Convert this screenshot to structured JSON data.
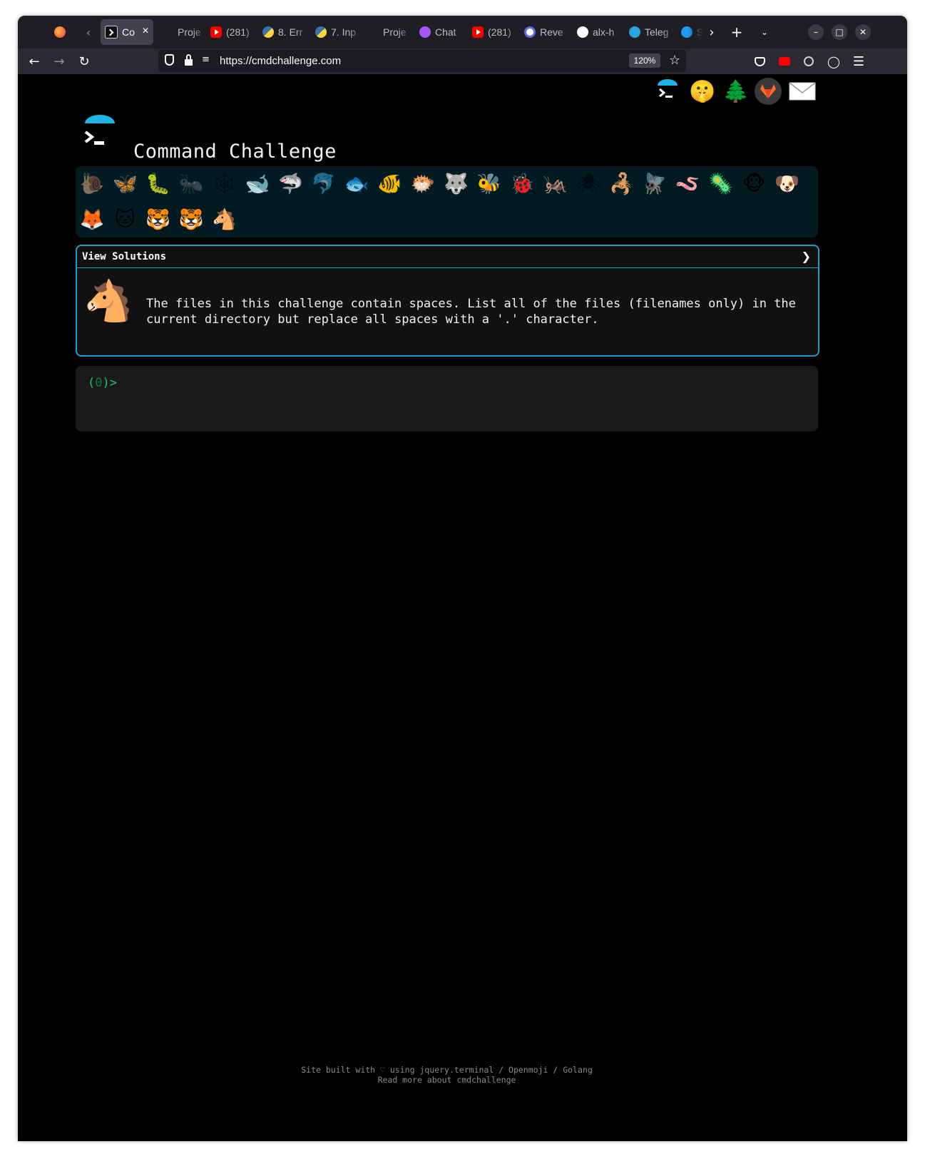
{
  "browser": {
    "tabs": [
      {
        "label": "Co",
        "icon": "terminal-icon",
        "active": true
      },
      {
        "label": "Proje",
        "icon": "blank-icon"
      },
      {
        "label": "(281)",
        "icon": "youtube-icon"
      },
      {
        "label": "8. Err",
        "icon": "python-icon"
      },
      {
        "label": "7. Inp",
        "icon": "python-icon"
      },
      {
        "label": "Proje",
        "icon": "blank-icon"
      },
      {
        "label": "Chat",
        "icon": "chat-icon"
      },
      {
        "label": "(281)",
        "icon": "youtube-icon"
      },
      {
        "label": "Reve",
        "icon": "reverso-icon"
      },
      {
        "label": "alx-h",
        "icon": "github-icon"
      },
      {
        "label": "Teleg",
        "icon": "telegram-icon"
      },
      {
        "label": "S",
        "icon": "twitter-icon"
      }
    ],
    "url": "https://cmdchallenge.com",
    "zoom": "120%"
  },
  "site": {
    "title": "Command Challenge",
    "header_icons": [
      "cmd-logo-icon",
      "shushing-face-icon",
      "tree-icon",
      "gitlab-icon",
      "envelope-icon"
    ]
  },
  "badges": [
    {
      "name": "snail-badge-icon",
      "glyph": "🐌",
      "dim": true
    },
    {
      "name": "butterfly-badge-icon",
      "glyph": "🦋"
    },
    {
      "name": "caterpillar-badge-icon",
      "glyph": "🐛"
    },
    {
      "name": "ant-badge-icon",
      "glyph": "🐜",
      "dim": true
    },
    {
      "name": "spider-web-badge-icon",
      "glyph": "🕸",
      "dim": true
    },
    {
      "name": "whale-badge-icon",
      "glyph": "🐋"
    },
    {
      "name": "shark-badge-icon",
      "glyph": "🦈"
    },
    {
      "name": "dolphin-badge-icon",
      "glyph": "🐬",
      "dim": true
    },
    {
      "name": "fish-badge-icon",
      "glyph": "🐟"
    },
    {
      "name": "tropical-fish-badge-icon",
      "glyph": "🐠"
    },
    {
      "name": "blowfish-badge-icon",
      "glyph": "🐡"
    },
    {
      "name": "wolf-badge-icon",
      "glyph": "🐺"
    },
    {
      "name": "bee-badge-icon",
      "glyph": "🐝"
    },
    {
      "name": "ladybug-badge-icon",
      "glyph": "🐞"
    },
    {
      "name": "cricket-badge-icon",
      "glyph": "🦗"
    },
    {
      "name": "spider-badge-icon",
      "glyph": "🕷",
      "dim": true
    },
    {
      "name": "scorpion-badge-icon",
      "glyph": "🦂"
    },
    {
      "name": "fly-badge-icon",
      "glyph": "🪰"
    },
    {
      "name": "worm-badge-icon",
      "glyph": "🪱"
    },
    {
      "name": "microbe-badge-icon",
      "glyph": "🦠"
    },
    {
      "name": "monkey-badge-icon",
      "glyph": "🐵"
    },
    {
      "name": "dog-badge-icon",
      "glyph": "🐶"
    },
    {
      "name": "fox-badge-icon",
      "glyph": "🦊"
    },
    {
      "name": "cat-badge-icon",
      "glyph": "🐱"
    },
    {
      "name": "tiger-badge-icon",
      "glyph": "🐯"
    },
    {
      "name": "tiger-face-badge-icon",
      "glyph": "🐯"
    },
    {
      "name": "horse-badge-icon",
      "glyph": "🐴"
    }
  ],
  "panel": {
    "header_label": "View Solutions",
    "header_arrow": "❯",
    "challenge_icon": "horse-icon",
    "description": "The files in this challenge contain spaces. List all of the files (filenames only) in the current directory but replace all spaces with a '.' character."
  },
  "terminal": {
    "prompt_open": "(",
    "prompt_count": "0",
    "prompt_close": ")>"
  },
  "footer": {
    "line1": "Site built with ♡ using jquery.terminal / Openmoji / Golang",
    "line2": "Read more about cmdchallenge"
  },
  "colors": {
    "accent": "#1d9bd1",
    "prompt_green": "#22c55e",
    "badge_bg": "#021a22",
    "terminal_bg": "#1a1a1a"
  }
}
